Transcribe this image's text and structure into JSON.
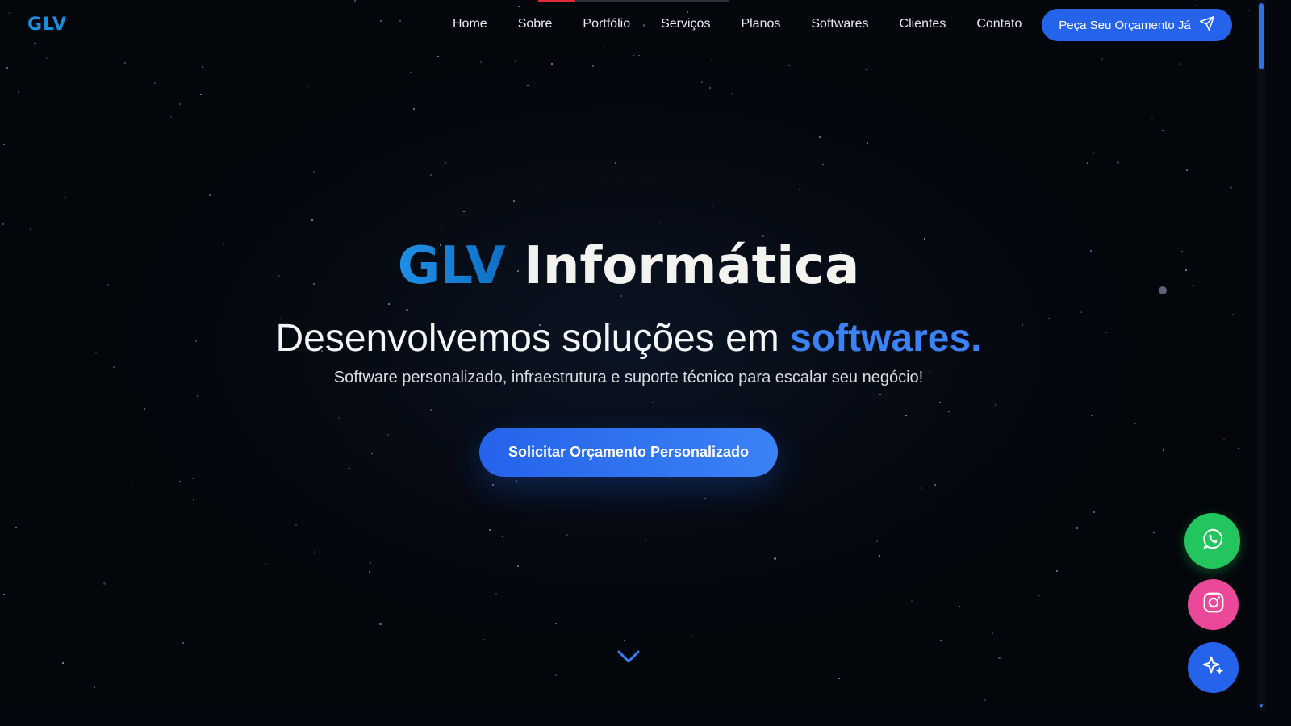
{
  "header": {
    "logo": "GLV",
    "nav": [
      "Home",
      "Sobre",
      "Portfólio",
      "Serviços",
      "Planos",
      "Softwares",
      "Clientes",
      "Contato"
    ],
    "cta_label": "Peça Seu Orçamento Já",
    "cta_icon": "send-icon"
  },
  "hero": {
    "title_brand": "GLV",
    "title_rest": "Informática",
    "subtitle_lead": "Desenvolvemos soluções em",
    "subtitle_accent": "softwares.",
    "description": "Software personalizado, infraestrutura e suporte técnico para escalar seu negócio!",
    "button_label": "Solicitar Orçamento Personalizado",
    "scroll_icon": "chevron-down-icon"
  },
  "floating_buttons": [
    {
      "name": "whatsapp",
      "icon": "whatsapp-icon",
      "color": "#22c55e"
    },
    {
      "name": "instagram",
      "icon": "instagram-icon",
      "color": "#ec4899"
    },
    {
      "name": "ai-assistant",
      "icon": "sparkles-icon",
      "color": "#2563eb"
    }
  ],
  "colors": {
    "accent": "#2563eb",
    "accent_light": "#3b82f6",
    "brand": "#1a8fe0",
    "background": "#04070d"
  }
}
